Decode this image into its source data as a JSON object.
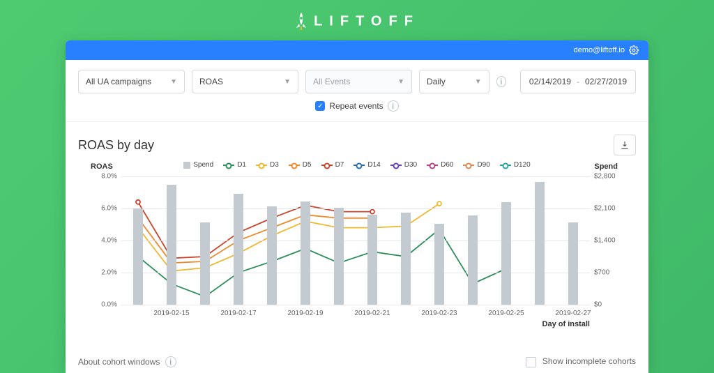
{
  "brand": "LIFTOFF",
  "account_email": "demo@liftoff.io",
  "filters": {
    "campaigns": "All UA campaigns",
    "metric": "ROAS",
    "events": "All Events",
    "granularity": "Daily",
    "date_start": "02/14/2019",
    "date_end": "02/27/2019",
    "repeat_events_label": "Repeat events"
  },
  "chart_title": "ROAS by day",
  "chart_ylabel_left": "ROAS",
  "chart_ylabel_right": "Spend",
  "chart_xlabel": "Day of install",
  "footer_about": "About cohort windows",
  "footer_incomplete": "Show incomplete cohorts",
  "chart_data": {
    "type": "combo-bar-line",
    "x": [
      "2019-02-14",
      "2019-02-15",
      "2019-02-16",
      "2019-02-17",
      "2019-02-18",
      "2019-02-19",
      "2019-02-20",
      "2019-02-21",
      "2019-02-22",
      "2019-02-23",
      "2019-02-24",
      "2019-02-25",
      "2019-02-26",
      "2019-02-27"
    ],
    "x_ticks": [
      "2019-02-15",
      "2019-02-17",
      "2019-02-19",
      "2019-02-21",
      "2019-02-23",
      "2019-02-25",
      "2019-02-27"
    ],
    "y_left_ticks": [
      "0.0%",
      "2.0%",
      "4.0%",
      "6.0%",
      "8.0%"
    ],
    "y_left_range": [
      0,
      8
    ],
    "y_right_ticks": [
      "$0",
      "$700",
      "$1,400",
      "$2,100",
      "$2,800"
    ],
    "y_right_range": [
      0,
      2800
    ],
    "spend": [
      2100,
      2620,
      1800,
      2420,
      2140,
      2260,
      2110,
      1960,
      2010,
      1760,
      1950,
      2240,
      2680,
      1790
    ],
    "series": [
      {
        "name": "Spend",
        "type": "bar",
        "color": "#c3cad0"
      },
      {
        "name": "D1",
        "color": "#2d8f5a",
        "values": [
          3.0,
          1.3,
          0.5,
          2.0,
          2.7,
          3.5,
          2.6,
          3.3,
          3.0,
          4.7,
          1.3,
          2.25,
          null,
          null
        ]
      },
      {
        "name": "D3",
        "color": "#f0b82e",
        "values": [
          4.8,
          2.1,
          2.3,
          3.2,
          4.3,
          5.2,
          4.8,
          4.8,
          4.9,
          6.3,
          null,
          null,
          null,
          null
        ]
      },
      {
        "name": "D5",
        "color": "#ee8a2b",
        "values": [
          5.4,
          2.6,
          2.7,
          4.0,
          4.8,
          5.6,
          5.4,
          5.4,
          null,
          null,
          null,
          null,
          null,
          null
        ]
      },
      {
        "name": "D7",
        "color": "#c9442a",
        "values": [
          6.4,
          2.9,
          3.0,
          4.5,
          5.4,
          6.2,
          5.8,
          5.8,
          null,
          null,
          null,
          null,
          null,
          null
        ]
      },
      {
        "name": "D14",
        "color": "#2b6cb0",
        "values": [
          null,
          null,
          null,
          null,
          null,
          null,
          null,
          null,
          null,
          null,
          null,
          null,
          null,
          null
        ]
      },
      {
        "name": "D30",
        "color": "#6a3fb5",
        "values": [
          null,
          null,
          null,
          null,
          null,
          null,
          null,
          null,
          null,
          null,
          null,
          null,
          null,
          null
        ]
      },
      {
        "name": "D60",
        "color": "#b0458d",
        "values": [
          null,
          null,
          null,
          null,
          null,
          null,
          null,
          null,
          null,
          null,
          null,
          null,
          null,
          null
        ]
      },
      {
        "name": "D90",
        "color": "#d68b52",
        "values": [
          null,
          null,
          null,
          null,
          null,
          null,
          null,
          null,
          null,
          null,
          null,
          null,
          null,
          null
        ]
      },
      {
        "name": "D120",
        "color": "#2aa6a0",
        "values": [
          null,
          null,
          null,
          null,
          null,
          null,
          null,
          null,
          null,
          null,
          null,
          null,
          null,
          null
        ]
      }
    ]
  }
}
